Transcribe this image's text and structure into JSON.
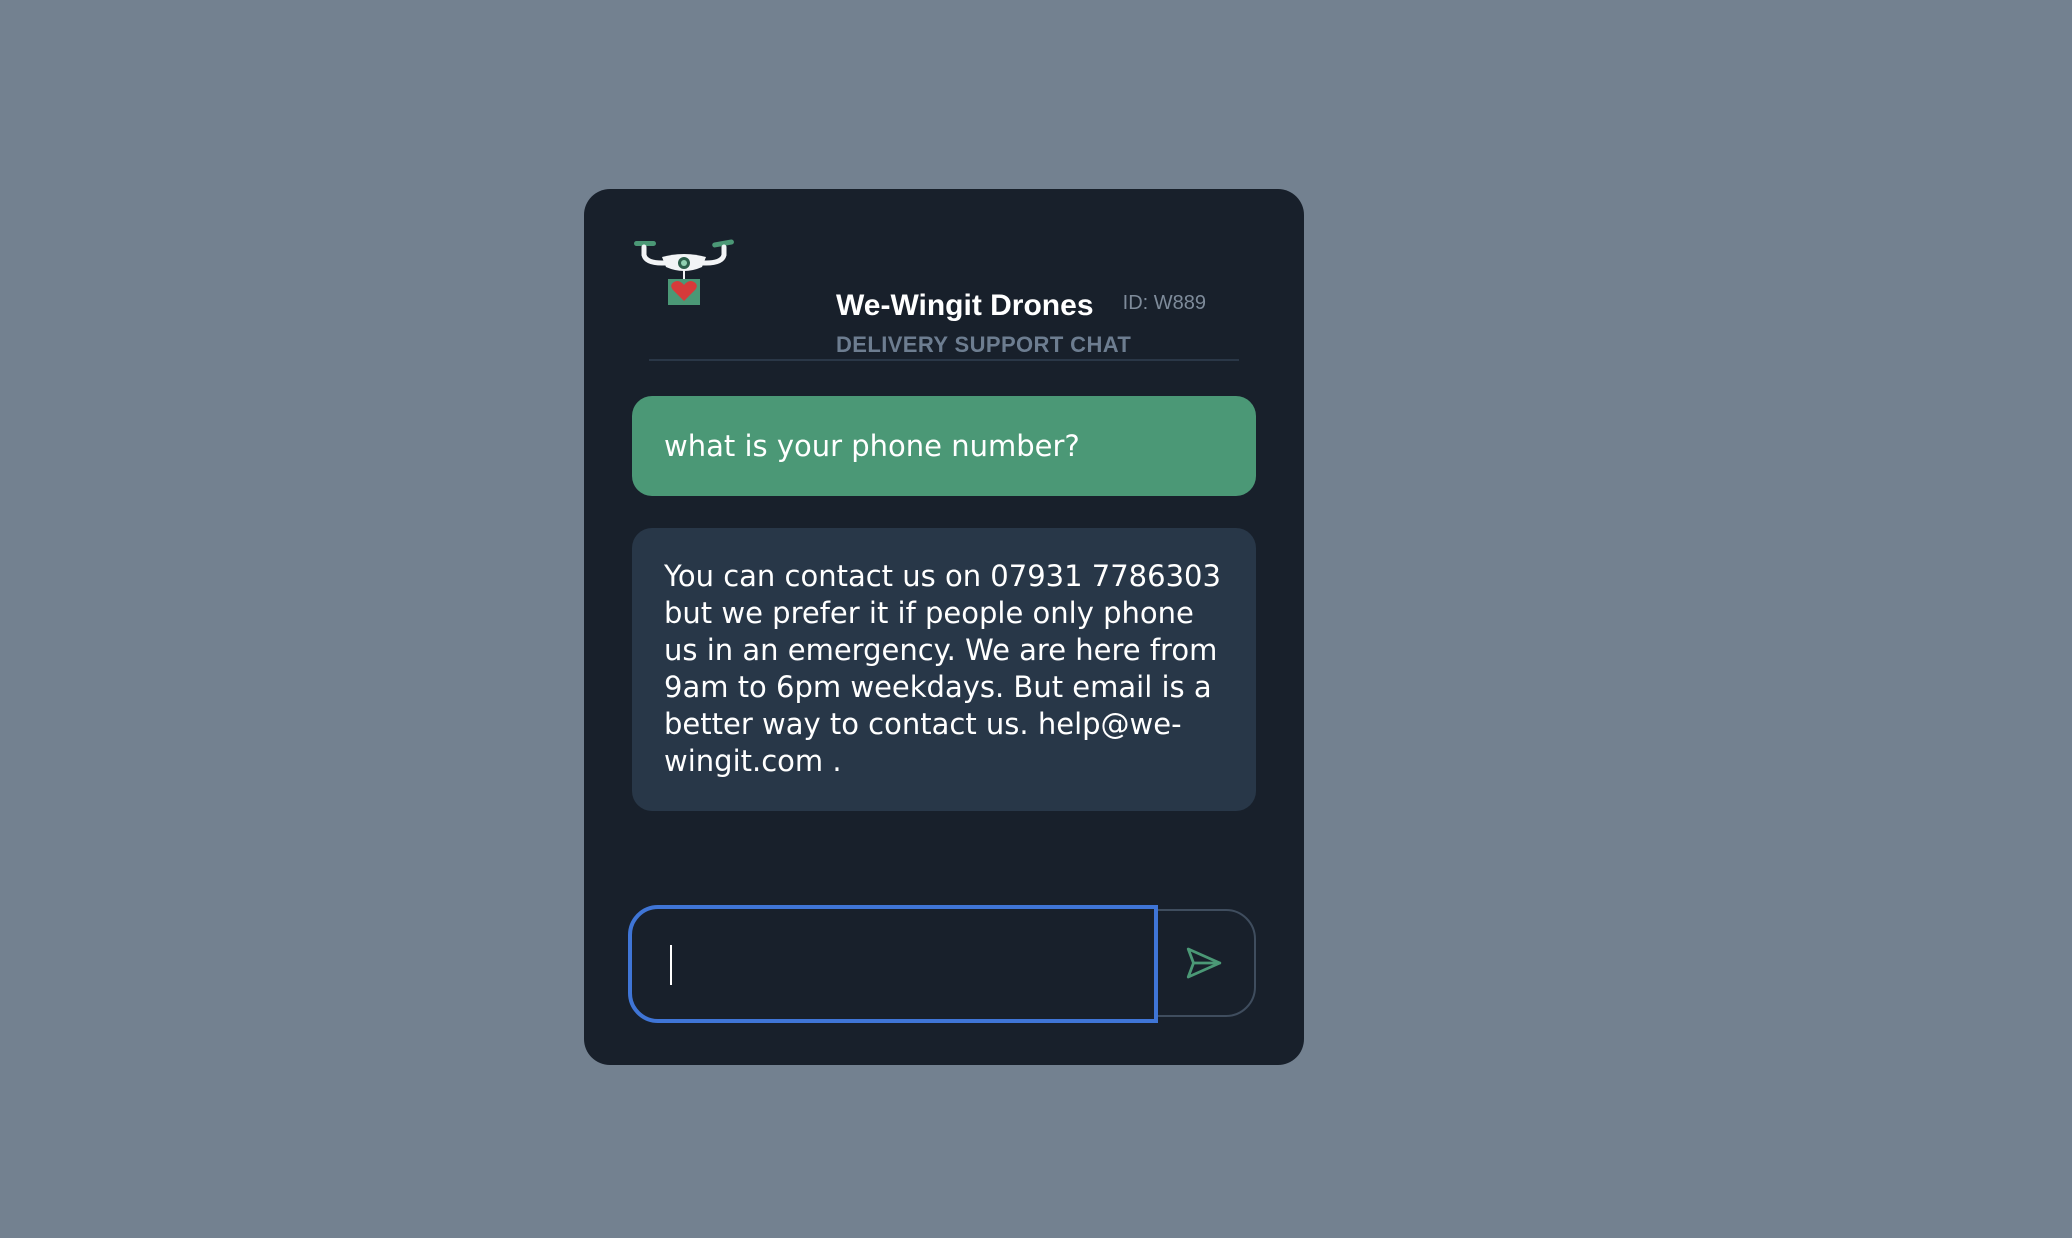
{
  "header": {
    "brand_name": "We-Wingit Drones",
    "subtitle": "DELIVERY SUPPORT CHAT",
    "chat_id": "ID: W889",
    "logo_icon": "drone-with-heart-package-icon"
  },
  "messages": [
    {
      "role": "user",
      "text": "what is your phone number?"
    },
    {
      "role": "bot",
      "text": "You can contact us on 07931 7786303 but we prefer it if people only phone us in an emergency. We are here from 9am to 6pm weekdays. But email is a better way to contact us. help@we-wingit.com ."
    }
  ],
  "composer": {
    "value": "",
    "placeholder": "",
    "send_icon": "send-icon"
  },
  "colors": {
    "page_background": "#738190",
    "card_background": "#18202b",
    "user_bubble": "#4b9876",
    "bot_bubble": "#283748",
    "accent_green": "#4b9876",
    "focus_ring": "#3f75d6",
    "heart_red": "#d63a3a"
  }
}
